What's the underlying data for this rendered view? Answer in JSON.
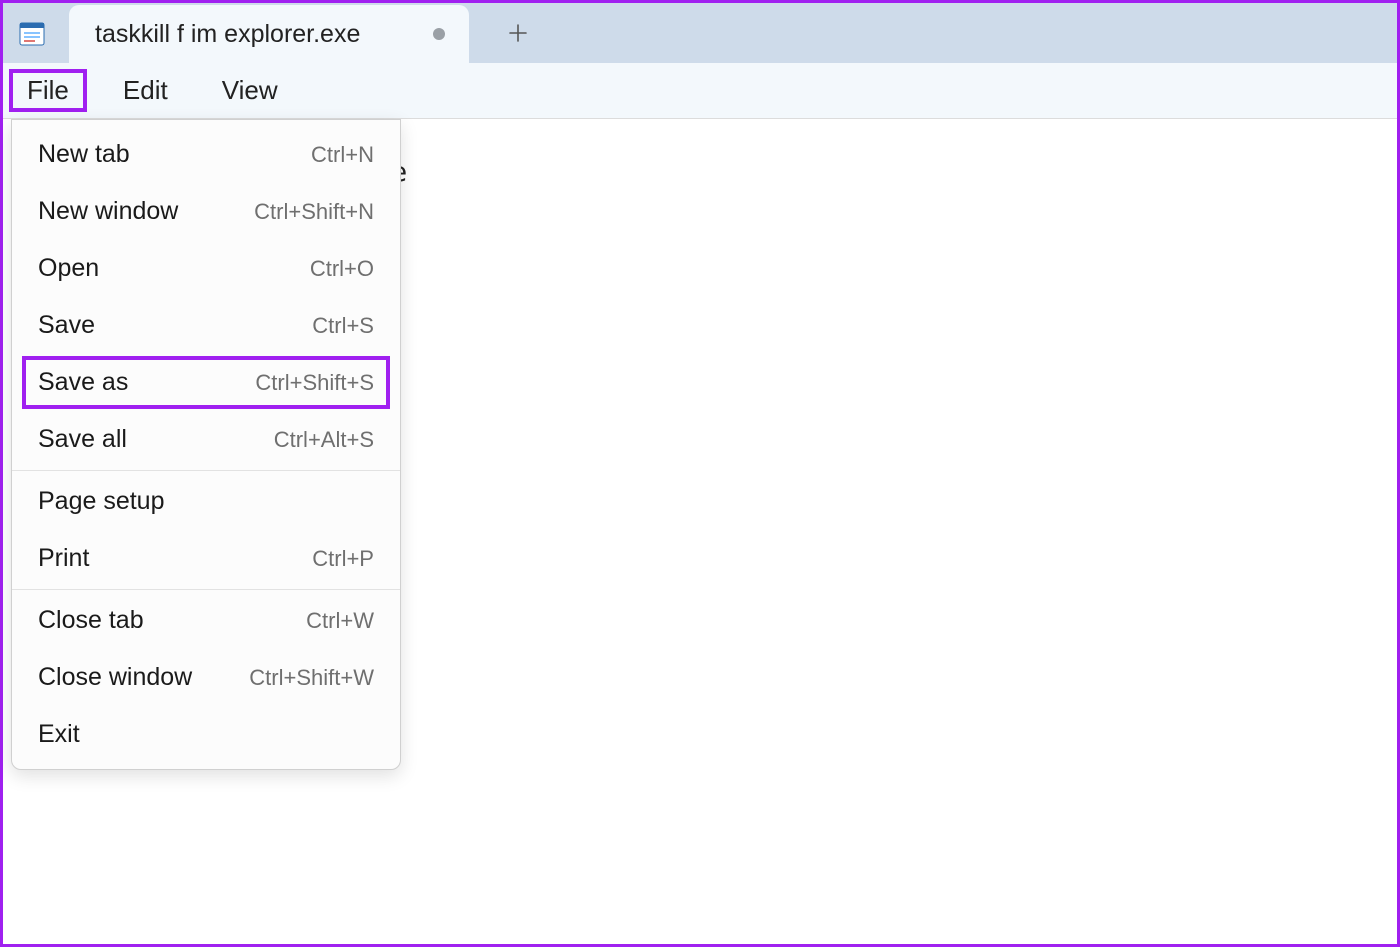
{
  "tab": {
    "title": "taskkill f im explorer.exe"
  },
  "menubar": {
    "file": "File",
    "edit": "Edit",
    "view": "View"
  },
  "editor": {
    "peek": "e"
  },
  "file_menu": {
    "new_tab": {
      "label": "New tab",
      "shortcut": "Ctrl+N"
    },
    "new_window": {
      "label": "New window",
      "shortcut": "Ctrl+Shift+N"
    },
    "open": {
      "label": "Open",
      "shortcut": "Ctrl+O"
    },
    "save": {
      "label": "Save",
      "shortcut": "Ctrl+S"
    },
    "save_as": {
      "label": "Save as",
      "shortcut": "Ctrl+Shift+S"
    },
    "save_all": {
      "label": "Save all",
      "shortcut": "Ctrl+Alt+S"
    },
    "page_setup": {
      "label": "Page setup",
      "shortcut": ""
    },
    "print": {
      "label": "Print",
      "shortcut": "Ctrl+P"
    },
    "close_tab": {
      "label": "Close tab",
      "shortcut": "Ctrl+W"
    },
    "close_window": {
      "label": "Close window",
      "shortcut": "Ctrl+Shift+W"
    },
    "exit": {
      "label": "Exit",
      "shortcut": ""
    }
  }
}
